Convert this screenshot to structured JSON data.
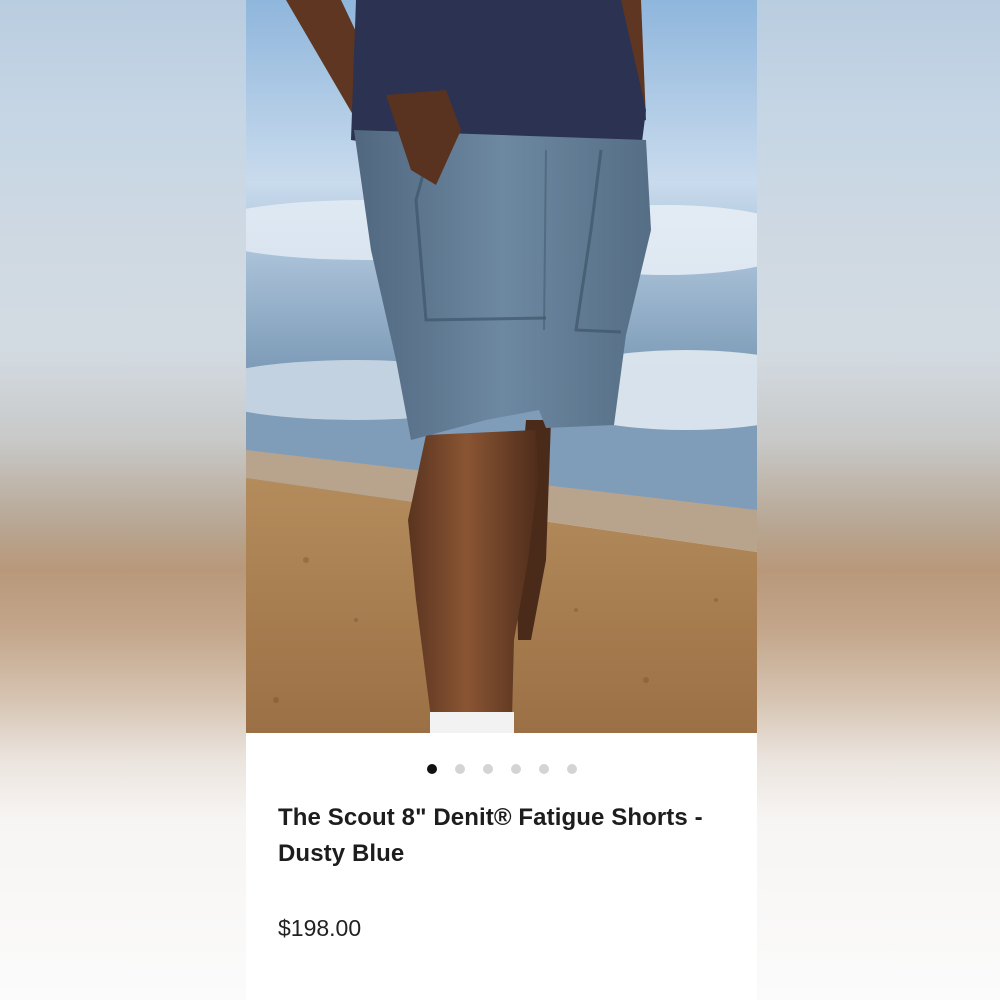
{
  "product": {
    "title": "The Scout 8\" Denit® Fatigue Shorts - Dusty Blue",
    "price": "$198.00",
    "image_subject": "model wearing dusty blue fatigue shorts standing on dirt ground with sky and clouds",
    "colors": {
      "shorts": "#5f7a93",
      "shirt": "#2b3252",
      "skin": "#7a4a2e",
      "sky": "#b9d1ea",
      "ground": "#a97f4e"
    }
  },
  "carousel": {
    "dots": [
      {
        "active": true
      },
      {
        "active": false
      },
      {
        "active": false
      },
      {
        "active": false
      },
      {
        "active": false
      },
      {
        "active": false
      }
    ]
  }
}
